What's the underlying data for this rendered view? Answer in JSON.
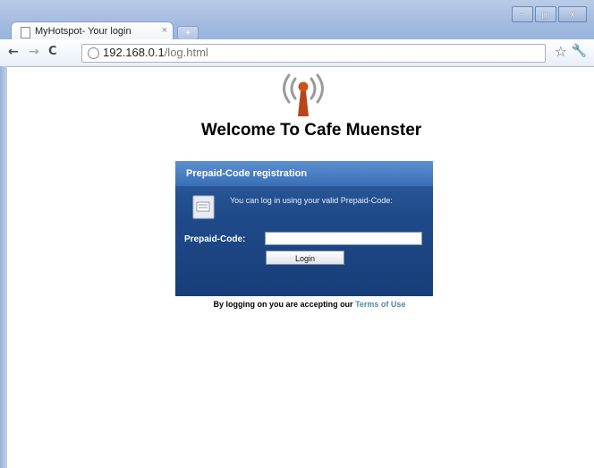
{
  "browser": {
    "tab_title": "MyHotspot- Your login",
    "tab_close": "×",
    "new_tab": "+",
    "url_host": "192.168.0.1",
    "url_path": "/log.html",
    "back": "←",
    "forward": "→",
    "reload": "C",
    "bookmark": "☆",
    "settings": "🔧",
    "window_controls": {
      "minimize": "–",
      "maximize": "□",
      "close": "x"
    }
  },
  "page": {
    "welcome": "Welcome To Cafe Muenster",
    "panel": {
      "title": "Prepaid-Code registration",
      "info": "You can log in using your valid Prepaid-Code:",
      "code_label": "Prepaid-Code:",
      "code_value": "",
      "login_button": "Login"
    },
    "terms_prefix": "By logging on you are accepting our",
    "terms_link": "Terms of Use"
  },
  "colors": {
    "panel_header": "#3a6fb5",
    "panel_body": "#1f4a8a",
    "terms_link": "#4a8aa8",
    "antenna": "#c9541a"
  }
}
